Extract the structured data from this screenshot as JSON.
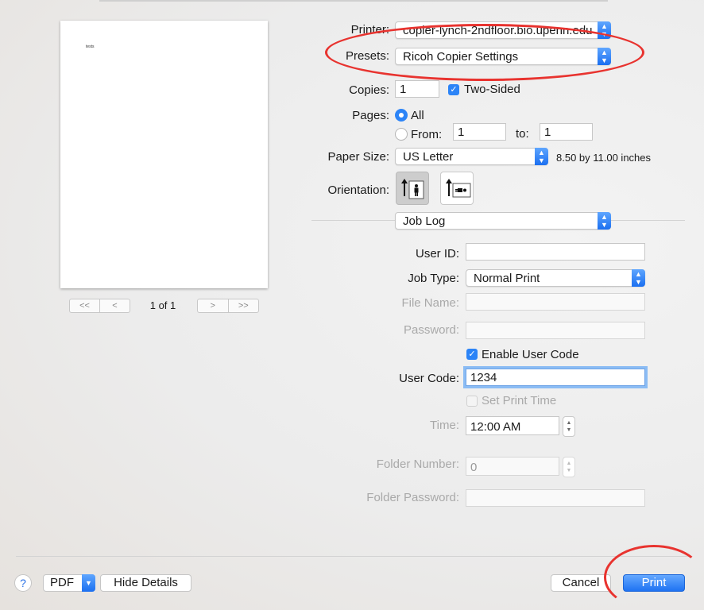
{
  "preview": {
    "paper_text": "tests",
    "page_label": "1 of 1",
    "nav_first": "<<",
    "nav_prev": "<",
    "nav_next": ">",
    "nav_last": ">>"
  },
  "printer": {
    "label": "Printer:",
    "value": "copier-lynch-2ndfloor.bio.upenn.edu"
  },
  "presets": {
    "label": "Presets:",
    "value": "Ricoh Copier Settings"
  },
  "copies": {
    "label": "Copies:",
    "value": "1",
    "two_sided_label": "Two-Sided",
    "two_sided_checked": true
  },
  "pages": {
    "label": "Pages:",
    "all_label": "All",
    "from_label": "From:",
    "from_value": "1",
    "to_label": "to:",
    "to_value": "1",
    "selected": "All"
  },
  "paper_size": {
    "label": "Paper Size:",
    "value": "US Letter",
    "dims": "8.50 by 11.00 inches"
  },
  "orientation": {
    "label": "Orientation:",
    "selected": "portrait"
  },
  "section": {
    "value": "Job Log"
  },
  "job": {
    "user_id_label": "User ID:",
    "user_id_value": "",
    "job_type_label": "Job Type:",
    "job_type_value": "Normal Print",
    "file_name_label": "File Name:",
    "file_name_value": "",
    "password_label": "Password:",
    "password_value": "",
    "enable_user_code_label": "Enable User Code",
    "enable_user_code_checked": true,
    "user_code_label": "User Code:",
    "user_code_value": "1234",
    "set_print_time_label": "Set Print Time",
    "set_print_time_checked": false,
    "time_label": "Time:",
    "time_value": "12:00 AM",
    "folder_number_label": "Folder Number:",
    "folder_number_value": "0",
    "folder_password_label": "Folder Password:",
    "folder_password_value": ""
  },
  "footer": {
    "help": "?",
    "pdf": "PDF",
    "hide_details": "Hide Details",
    "cancel": "Cancel",
    "print": "Print"
  },
  "colors": {
    "accent": "#2c84f7",
    "annotation": "#e8332f"
  }
}
